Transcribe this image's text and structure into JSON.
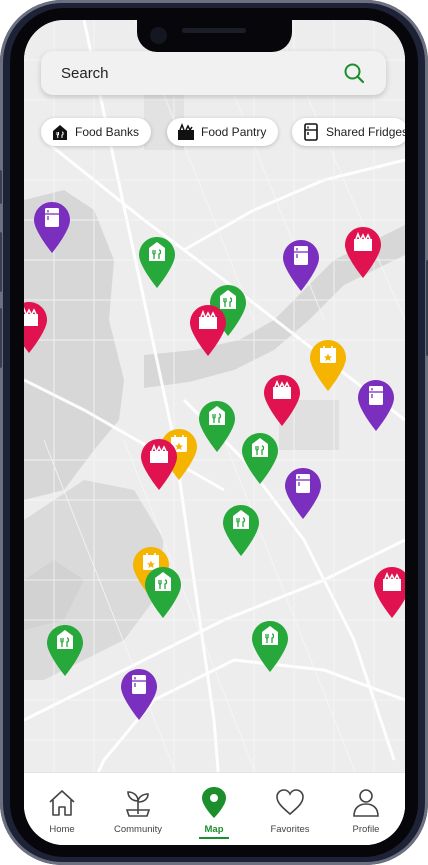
{
  "colors": {
    "accent": "#1c8f2c",
    "food_bank": "#27a83a",
    "food_pantry": "#e0124f",
    "shared_fridge": "#7b2fbf",
    "event": "#f5b400"
  },
  "search": {
    "label": "Search",
    "icon": "search-icon"
  },
  "filters": [
    {
      "label": "Food Banks",
      "icon": "food-bank-icon"
    },
    {
      "label": "Food Pantry",
      "icon": "food-pantry-icon"
    },
    {
      "label": "Shared Fridges",
      "icon": "fridge-icon"
    }
  ],
  "map": {
    "pin_types": [
      "food-bank",
      "food-pantry",
      "shared-fridge",
      "event"
    ]
  },
  "tabbar": {
    "active": "Map",
    "tabs": [
      {
        "label": "Home",
        "icon": "home-icon"
      },
      {
        "label": "Community",
        "icon": "plant-icon"
      },
      {
        "label": "Map",
        "icon": "map-pin-icon"
      },
      {
        "label": "Favorites",
        "icon": "heart-icon"
      },
      {
        "label": "Profile",
        "icon": "person-icon"
      }
    ]
  }
}
